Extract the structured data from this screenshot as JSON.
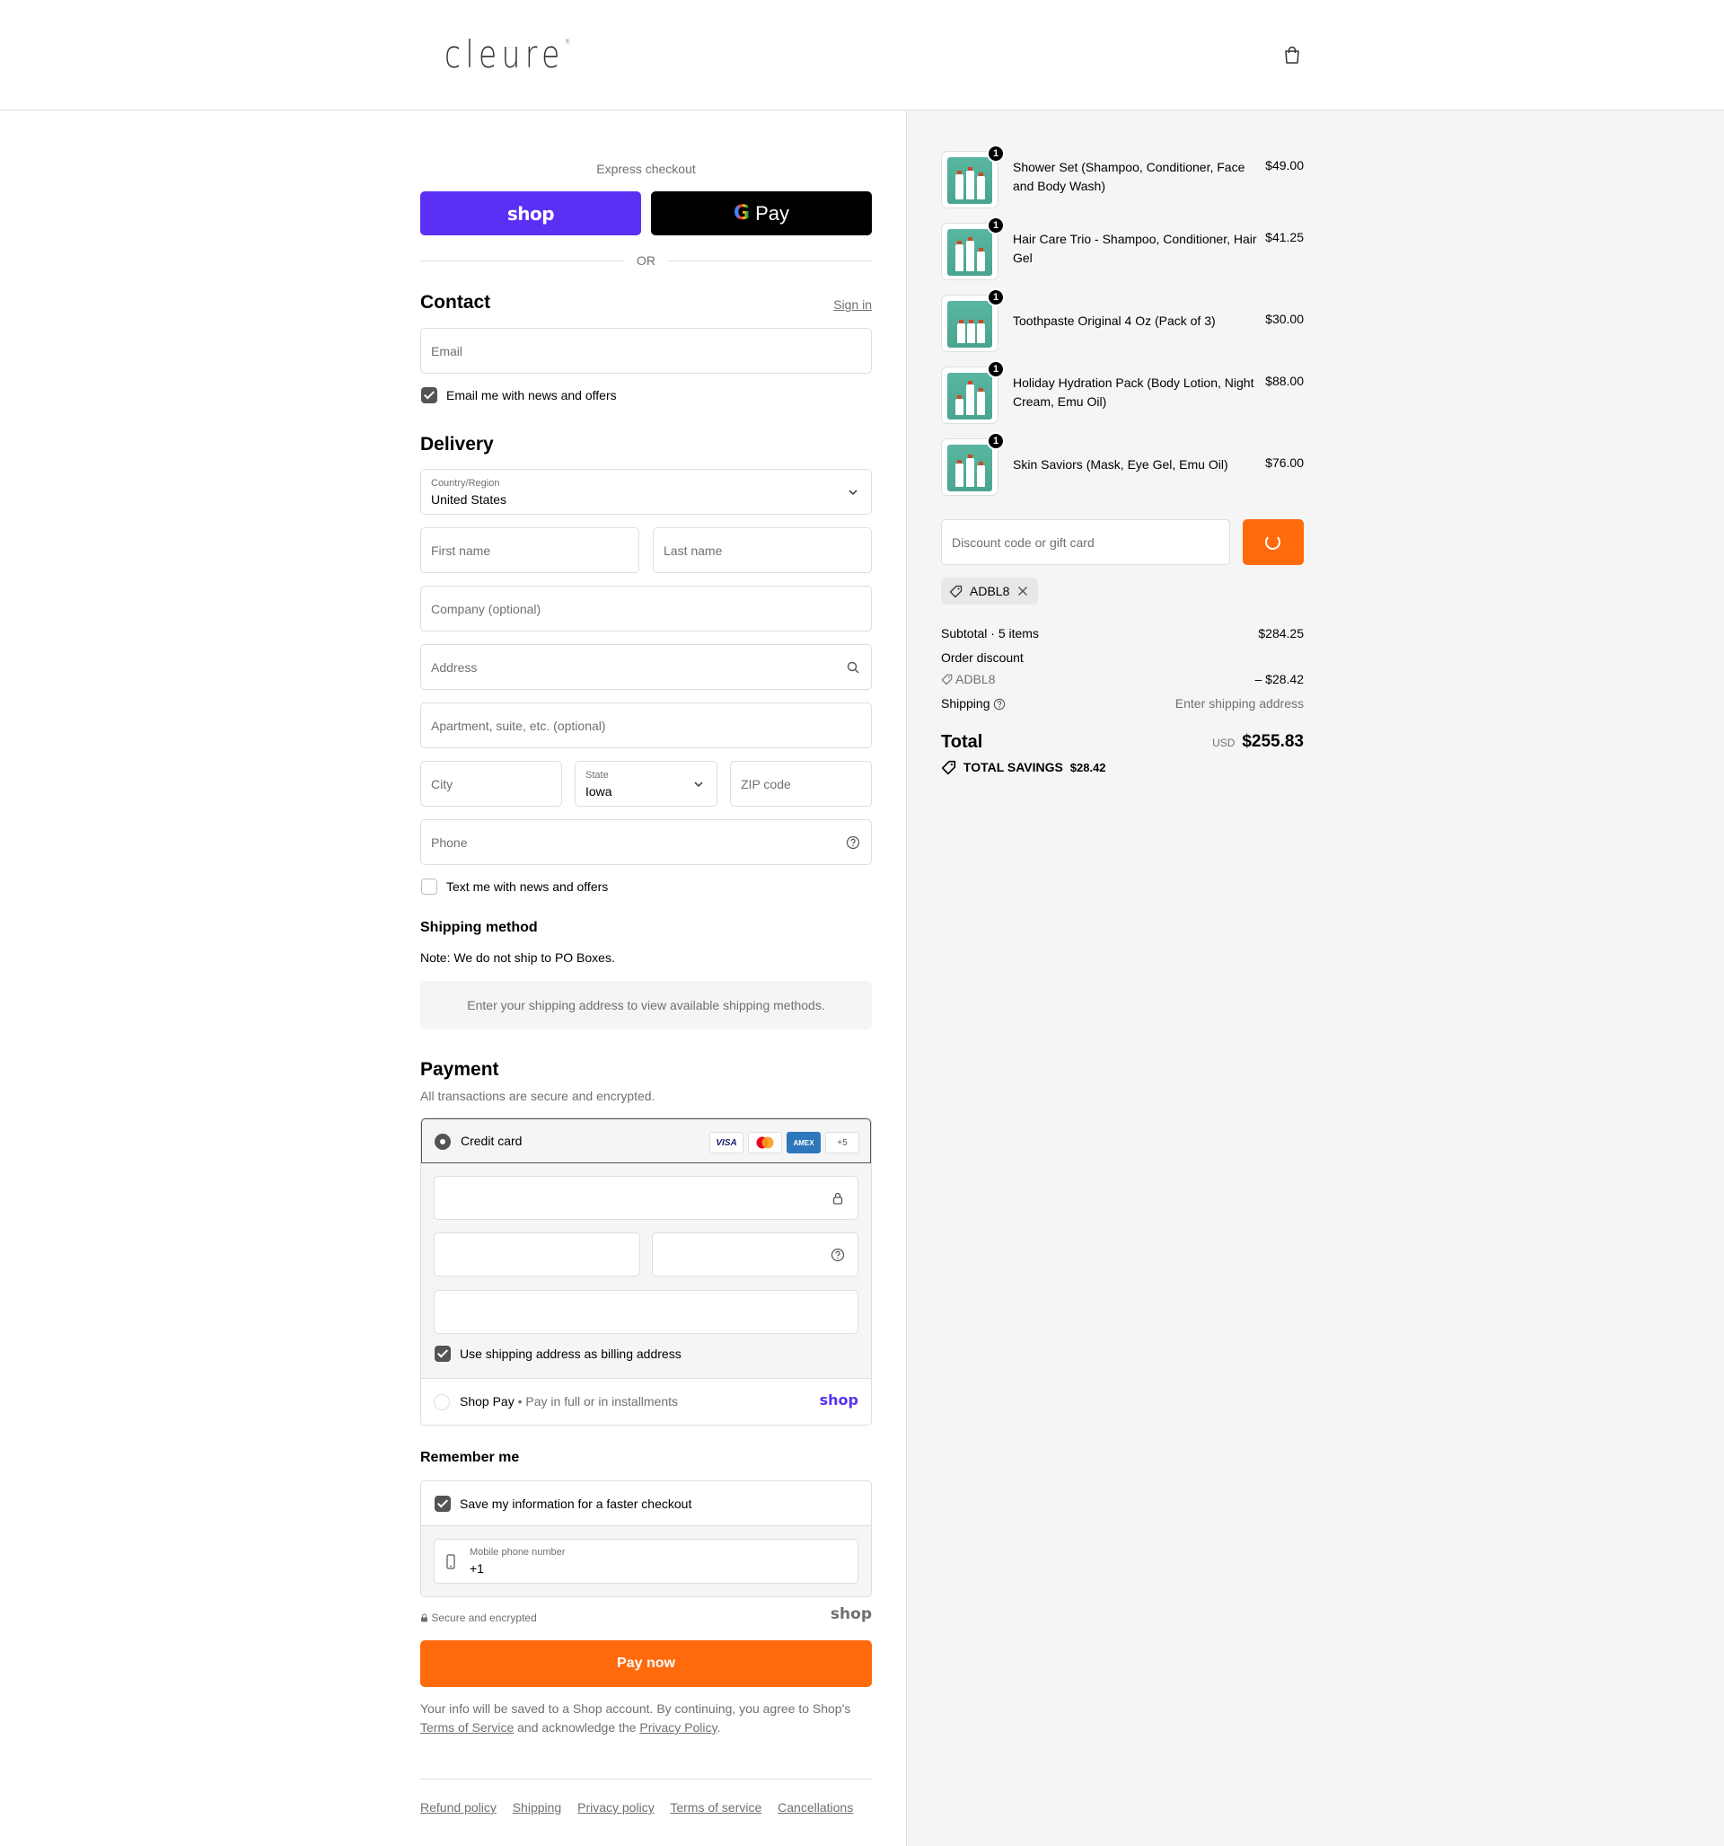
{
  "header": {
    "logo": "cleure",
    "logo_mark": "®",
    "cart_icon": "shopping-bag-icon"
  },
  "express": {
    "label": "Express checkout",
    "shop_pay_label": "shop",
    "gpay_label": "Pay",
    "gpay_g": "G",
    "or_label": "OR"
  },
  "contact": {
    "title": "Contact",
    "sign_in": "Sign in",
    "email_placeholder": "Email",
    "newsletter_label": "Email me with news and offers",
    "newsletter_checked": true
  },
  "delivery": {
    "title": "Delivery",
    "country_label": "Country/Region",
    "country_value": "United States",
    "first_name_placeholder": "First name",
    "last_name_placeholder": "Last name",
    "company_placeholder": "Company (optional)",
    "address_placeholder": "Address",
    "apartment_placeholder": "Apartment, suite, etc. (optional)",
    "city_placeholder": "City",
    "state_label": "State",
    "state_value": "Iowa",
    "zip_placeholder": "ZIP code",
    "phone_placeholder": "Phone",
    "sms_label": "Text me with news and offers",
    "sms_checked": false
  },
  "shipping_method": {
    "title": "Shipping method",
    "note": "Note: We do not ship to PO Boxes.",
    "placeholder": "Enter your shipping address to view available shipping methods."
  },
  "payment": {
    "title": "Payment",
    "subtitle": "All transactions are secure and encrypted.",
    "credit_card_label": "Credit card",
    "card_brands": [
      "VISA",
      "MC",
      "AMEX",
      "+5"
    ],
    "billing_same_label": "Use shipping address as billing address",
    "billing_same_checked": true,
    "shop_pay_label": "Shop Pay",
    "shop_pay_sub": "Pay in full or in installments",
    "shop_pay_logo": "shop"
  },
  "remember": {
    "title": "Remember me",
    "save_label": "Save my information for a faster checkout",
    "save_checked": true,
    "mobile_label": "Mobile phone number",
    "mobile_value": "+1"
  },
  "secure": {
    "label": "Secure and encrypted",
    "shop_logo": "shop"
  },
  "pay_now_label": "Pay now",
  "legal": {
    "part1": "Your info will be saved to a Shop account. By continuing, you agree to Shop's",
    "tos": "Terms of Service",
    "part2": "and acknowledge the",
    "privacy": "Privacy Policy",
    "part3": "."
  },
  "footer_links": [
    "Refund policy",
    "Shipping",
    "Privacy policy",
    "Terms of service",
    "Cancellations"
  ],
  "summary": {
    "items": [
      {
        "name": "Shower Set (Shampoo, Conditioner, Face and Body Wash)",
        "price": "$49.00",
        "qty": "1"
      },
      {
        "name": "Hair Care Trio - Shampoo, Conditioner, Hair Gel",
        "price": "$41.25",
        "qty": "1"
      },
      {
        "name": "Toothpaste Original 4 Oz (Pack of 3)",
        "price": "$30.00",
        "qty": "1"
      },
      {
        "name": "Holiday Hydration Pack (Body Lotion, Night Cream, Emu Oil)",
        "price": "$88.00",
        "qty": "1"
      },
      {
        "name": "Skin Saviors (Mask, Eye Gel, Emu Oil)",
        "price": "$76.00",
        "qty": "1"
      }
    ],
    "discount_placeholder": "Discount code or gift card",
    "applied_code": "ADBL8",
    "subtotal_label": "Subtotal · 5 items",
    "subtotal_value": "$284.25",
    "order_discount_label": "Order discount",
    "discount_code": "ADBL8",
    "discount_value": "– $28.42",
    "shipping_label": "Shipping",
    "shipping_value": "Enter shipping address",
    "total_label": "Total",
    "currency": "USD",
    "total_value": "$255.83",
    "savings_label": "TOTAL SAVINGS",
    "savings_value": "$28.42"
  },
  "colors": {
    "accent": "#ff6a0d",
    "shop_purple": "#5a31f4",
    "summary_bg": "#f5f5f5"
  }
}
